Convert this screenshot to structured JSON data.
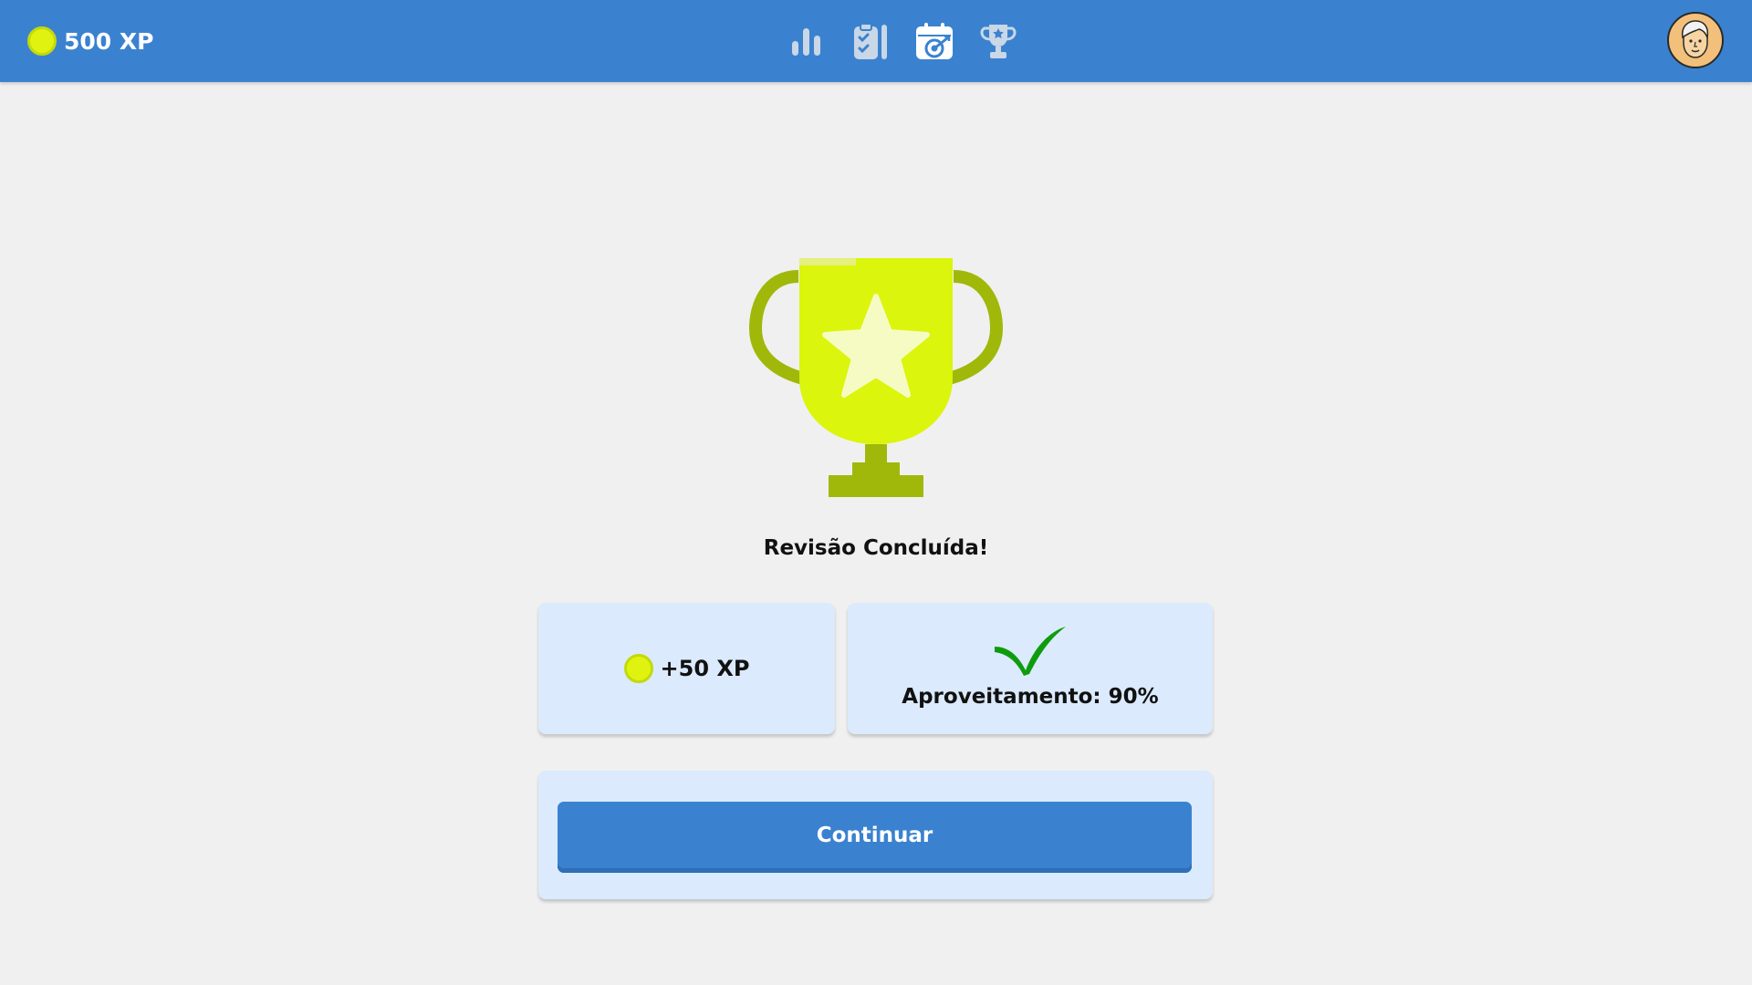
{
  "header": {
    "xp_label": "500 XP",
    "nav_icons": [
      "bar-chart-icon",
      "clipboard-check-icon",
      "calendar-target-icon",
      "trophy-star-icon"
    ],
    "avatar_icon": "user-avatar-icon"
  },
  "main": {
    "trophy_icon": "trophy-star-icon",
    "title": "Revisão Concluída!",
    "xp_card": {
      "icon": "coin-icon",
      "label": "+50 XP"
    },
    "score_card": {
      "icon": "checkmark-icon",
      "label": "Aproveitamento: 90%",
      "score_percent": 90
    },
    "continue_label": "Continuar"
  },
  "colors": {
    "primary": "#3a82d0",
    "background": "#f0f0f0",
    "card": "#dbeafc",
    "coin": "#e0f20f",
    "trophy": "#dbf50c",
    "trophy_dark": "#a0b80a",
    "check": "#0e9c0e"
  }
}
